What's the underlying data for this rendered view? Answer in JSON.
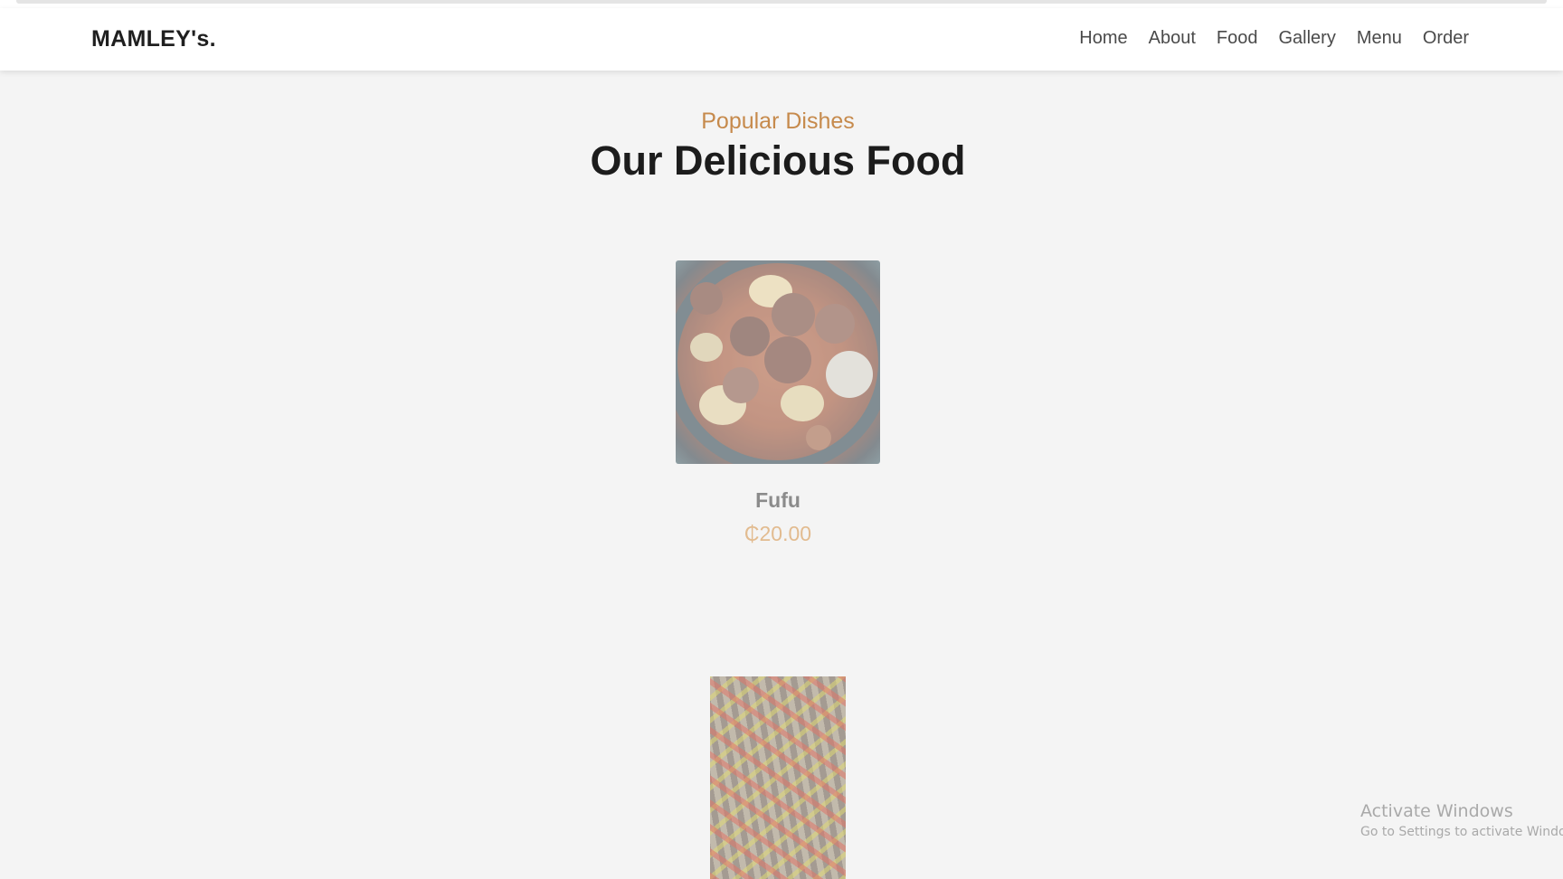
{
  "brand": "MAMLEY's.",
  "nav": {
    "items": [
      "Home",
      "About",
      "Food",
      "Gallery",
      "Menu",
      "Order"
    ]
  },
  "section": {
    "subtitle": "Popular Dishes",
    "title": "Our Delicious Food"
  },
  "dishes": [
    {
      "name": "Fufu",
      "price": "₵20.00",
      "image": "fufu-dish-image"
    },
    {
      "name": "",
      "price": "",
      "image": "pepper-stir-fry-image"
    }
  ],
  "watermark": {
    "line1": "Activate Windows",
    "line2": "Go to Settings to activate Windows."
  },
  "colors": {
    "accent": "#c68a4c",
    "price": "#e2bb8f",
    "background": "#f4f4f4",
    "header": "#ffffff"
  }
}
